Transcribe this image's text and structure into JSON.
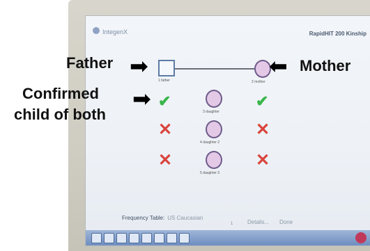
{
  "app": {
    "brand": "IntegenX",
    "title": "RapidHIT 200 Kinship"
  },
  "pedigree": {
    "father_label": "1 father",
    "mother_label": "2 mother",
    "children": [
      {
        "label": "3 daughter"
      },
      {
        "label": "4 daughter 2"
      },
      {
        "label": "5 daughter 3"
      }
    ],
    "results_left": [
      "check",
      "cross",
      "cross"
    ],
    "results_right": [
      "check",
      "cross",
      "cross"
    ],
    "check_glyph": "✔",
    "cross_glyph": "✕"
  },
  "footer": {
    "freq_label": "Frequency Table:",
    "freq_value": "US Caucasian",
    "page": "1",
    "details": "Details...",
    "done": "Done"
  },
  "annotations": {
    "father": "Father",
    "mother": "Mother",
    "child_line1": "Confirmed",
    "child_line2": "child of both",
    "arrow_glyph_right": "➡",
    "arrow_glyph_left": "⬅"
  },
  "colors": {
    "check": "#39b54a",
    "cross": "#d9443c",
    "male": "#5d7ba5",
    "female_fill": "#e3c9e6"
  }
}
